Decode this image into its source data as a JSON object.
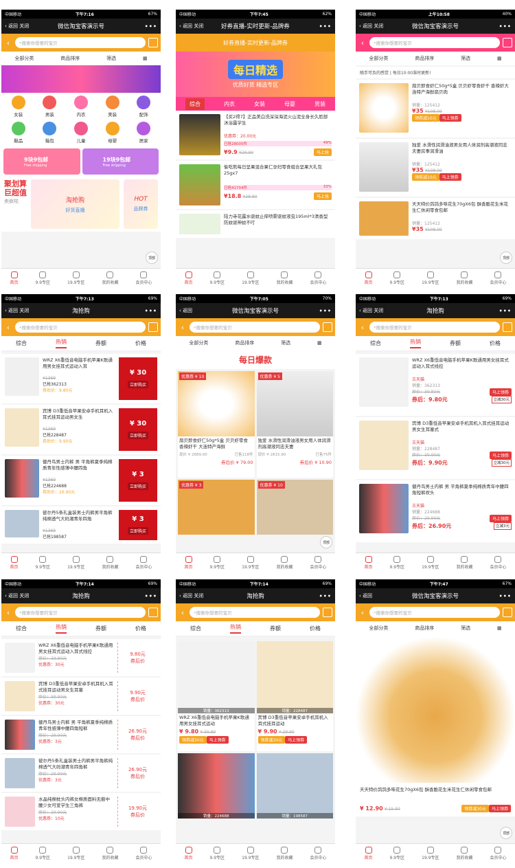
{
  "common": {
    "carrier": "中国移动",
    "back": "返回",
    "close": "关闭",
    "more": "•••",
    "search_placeholder": "搜索你想要的宝贝",
    "nav": [
      "首页",
      "9.9专区",
      "19.9专区",
      "我的收藏",
      "会员中心"
    ],
    "top_label": "顶部"
  },
  "screens": [
    {
      "time": "下午7:16",
      "battery": "67%",
      "title": "微信淘宝客演示号",
      "filters": [
        "全部分类",
        "商品排序",
        "筛选"
      ],
      "icons": [
        "女装",
        "男装",
        "内衣",
        "美装",
        "配饰",
        "鞋品",
        "箱包",
        "儿童",
        "母婴",
        "居家"
      ],
      "promo": [
        {
          "t": "9块9包邮",
          "s": "Free shipping"
        },
        {
          "t": "19块9包邮",
          "s": "Free shipping"
        }
      ],
      "jhs": [
        "聚划算",
        "巨超值",
        "卖疯啦"
      ],
      "tqg": "淘抢购",
      "hot": "HOT",
      "tiles": [
        "好货直播",
        "品牌券"
      ]
    },
    {
      "time": "下午7:45",
      "battery": "62%",
      "title": "好券直播-实时更新-品牌券",
      "sub": "好券直播-实时更新-品牌券",
      "banner1": "每日精选",
      "banner2": "优质好货  精选专区",
      "tabs": [
        "综合",
        "内衣",
        "女装",
        "母婴",
        "男装"
      ],
      "items": [
        {
          "name": "【买2得7】正品美白洗深深海泥火山泥全身长久脸部沐浴露学生",
          "coupon": "优惠券：20.00元",
          "sold": "已抢28005件",
          "pct": "49%",
          "price": "¥9.9",
          "org": "¥29.90",
          "btn": "马上抢"
        },
        {
          "name": "偷吃熊每日坚果混合果仁孕妇零食组合坚果大礼包25gx7",
          "coupon": "",
          "sold": "已抢41704件",
          "pct": "33%",
          "price": "¥18.8",
          "org": "¥28.80",
          "btn": "马上抢"
        },
        {
          "name": "陆力寺花露水驱蚊止痒喷雾驱蚊液虫195ml*3清香型防蚊驱神蚊不叮",
          "coupon": "",
          "sold": "",
          "pct": "",
          "price": "",
          "org": "",
          "btn": ""
        }
      ]
    },
    {
      "time": "上午10:58",
      "battery": "40%",
      "title": "微信淘宝客演示号",
      "filters": [
        "全部分类",
        "商品排序",
        "筛选"
      ],
      "notice": "随手可及的感觉 | 每日10:00准时更新!",
      "items": [
        {
          "name": "扇贝即食虾仁50g*5盒 贝贝虾零食虾干 香辣虾大连特产海鲜扇贝肉",
          "sales": "销量：125412",
          "price": "¥35",
          "org": "¥108.00",
          "coupon": "领券减10元",
          "btn": "马上领券"
        },
        {
          "name": "独爱 水滑性润滑油液男女用人体润剂高潮液同志夫妻房事润滑油",
          "sales": "销量：125412",
          "price": "¥35",
          "org": "¥108.00",
          "coupon": "领券减10元",
          "btn": "马上领券"
        },
        {
          "name": "天天特价鸽鸽多味花生70gX6包 酥香脆花生米花生仁休闲零食包邮",
          "sales": "销量：125412",
          "price": "¥35",
          "org": "¥108.00",
          "coupon": "",
          "btn": ""
        }
      ]
    },
    {
      "time": "下午7:13",
      "battery": "69%",
      "title": "淘抢购",
      "tabs": [
        "综合",
        "热销",
        "券额",
        "价格"
      ],
      "items": [
        {
          "name": "WRZ X6重低音电脑手机苹果K歌通用男女挂耳式运动入耳",
          "org": "¥1369",
          "sold": "已抢362313",
          "after": "券后价：9.80元",
          "amt": "¥ 30",
          "btn": "立即购买"
        },
        {
          "name": "宾博 D3重低音苹果安卓手机耳机入耳式挂耳运动男女生",
          "org": "¥1369",
          "sold": "已抢228487",
          "after": "券后价：9.90元",
          "amt": "¥ 30",
          "btn": "立即购买"
        },
        {
          "name": "健丹鸟男士内裤 男 平角裤夏季纯棉质青年性感薄中腰四角",
          "org": "¥1369",
          "sold": "已抢224688",
          "after": "券后价：26.90元",
          "amt": "¥ 3",
          "btn": "立即购买"
        },
        {
          "name": "彼尔丹5条礼盒装男士内裤男平角裤纯棉透气大码潮青年四角",
          "org": "¥1369",
          "sold": "已抢198587",
          "after": "",
          "amt": "¥ 3",
          "btn": "立即购买"
        }
      ]
    },
    {
      "time": "下午7:05",
      "battery": "70%",
      "title": "微信淘宝客演示号",
      "filters": [
        "全部分类",
        "商品排序",
        "筛选"
      ],
      "banner": "每日爆款",
      "cards": [
        {
          "tag": "优惠券 ¥ 10",
          "name": "扇贝即食虾仁50g*5盒 贝贝虾零食 香辣虾干 大连特产海鲜",
          "cur": "现价 ¥ 2689.00",
          "sold": "已售118件",
          "after": "券后价 ¥ 79.00"
        },
        {
          "tag": "优惠券 ¥ 5",
          "name": "独爱 水滑性润滑油液男女用人体润滑剂高潮液同志夫妻",
          "cur": "现价 ¥ 2815.90",
          "sold": "已售75件",
          "after": "券后价 ¥ 10.90"
        },
        {
          "tag": "优惠券 ¥ 3",
          "name": "",
          "cur": "",
          "sold": "",
          "after": ""
        },
        {
          "tag": "优惠券 ¥ 10",
          "name": "",
          "cur": "",
          "sold": "",
          "after": ""
        }
      ]
    },
    {
      "time": "下午7:13",
      "battery": "69%",
      "title": "淘抢购",
      "tabs": [
        "综合",
        "热销",
        "券额",
        "价格"
      ],
      "items": [
        {
          "name": "WRZ X6重低音电脑手机苹果K歌通用男女挂耳式运动入耳式线控",
          "shop": "古天猫",
          "sales": "销量：362313",
          "org": "原价：39.80元",
          "after": "券后：9.80元",
          "btn": "马上领券",
          "cp": "立减30元"
        },
        {
          "name": "宾博 D3重低音苹果安卓手机耳机入耳式挂耳运动男女生耳塞式",
          "shop": "古天猫",
          "sales": "销量：228487",
          "org": "原价：39.90元",
          "after": "券后：9.90元",
          "btn": "马上领券",
          "cp": "立减30元"
        },
        {
          "name": "健丹鸟男士内裤 男 平角裤夏季纯棉质青年中腰四角短裤衩头",
          "shop": "古天猫",
          "sales": "销量：224688",
          "org": "原价：29.90元",
          "after": "券后：26.90元",
          "btn": "马上领券",
          "cp": "立减3元"
        }
      ]
    },
    {
      "time": "下午7:14",
      "battery": "69%",
      "title": "淘抢购",
      "tabs": [
        "综合",
        "热销",
        "券额",
        "价格"
      ],
      "items": [
        {
          "name": "WRZ X6重低音电脑手机苹果K歌通用男女挂耳式运动入耳式线控",
          "org": "原价：39.80元",
          "coupon": "优惠券：30元",
          "after": "9.80元",
          "al": "券后价"
        },
        {
          "name": "宾博 D3重低音苹果安卓手机耳机入耳式挂耳运动男女生耳塞",
          "org": "原价：39.90元",
          "coupon": "优惠券：30元",
          "after": "9.90元",
          "al": "券后价"
        },
        {
          "name": "健丹鸟男士内裤 男 平角裤夏季纯棉质青年性感薄中腰四角短裤",
          "org": "原价：29.90元",
          "coupon": "优惠券：3元",
          "after": "26.90元",
          "al": "券后价"
        },
        {
          "name": "彼尔丹5条礼盒装男士内裤男平角裤纯棉透气大码潮青年四角裤",
          "org": "原价：29.90元",
          "coupon": "优惠券：3元",
          "after": "26.90元",
          "al": "券后价"
        },
        {
          "name": "水晶纯棉枕头内裤女棉质面料无痕中腰少女可爱学生三角裤",
          "org": "原价：29.90元",
          "coupon": "优惠券：10元",
          "after": "19.90元",
          "al": "券后价"
        }
      ]
    },
    {
      "time": "下午7:14",
      "battery": "69%",
      "title": "淘抢购",
      "tabs": [
        "综合",
        "热销",
        "券额",
        "价格"
      ],
      "cards": [
        {
          "sales": "销量：362313",
          "name": "WRZ X6重低音电脑手机苹果K歌通用男女挂耳式运动",
          "price": "¥ 9.80",
          "org": "¥ 39.80",
          "cp": "领券减30元",
          "btn": "马上领券"
        },
        {
          "sales": "销量：228487",
          "name": "宾博 D3重低音苹果安卓手机耳机入耳式挂耳运动",
          "price": "¥ 9.90",
          "org": "¥ 29.90",
          "cp": "领券减30元",
          "btn": "马上领券"
        },
        {
          "sales": "销量：224688",
          "name": "",
          "price": "",
          "org": "",
          "cp": "",
          "btn": ""
        },
        {
          "sales": "销量：198587",
          "name": "",
          "price": "",
          "org": "",
          "cp": "",
          "btn": ""
        }
      ]
    },
    {
      "time": "下午7:47",
      "battery": "67%",
      "title": "微信淘宝客演示号",
      "filters": [
        "全部分类",
        "商品排序",
        "筛选"
      ],
      "name": "天天特价鸽鸽多味花生70gX6包 酥香脆花生米花生仁休闲零食包邮",
      "price": "¥ 12.90",
      "org": "¥ 15.90",
      "cp": "领券减30元",
      "btn": "马上领券"
    }
  ]
}
